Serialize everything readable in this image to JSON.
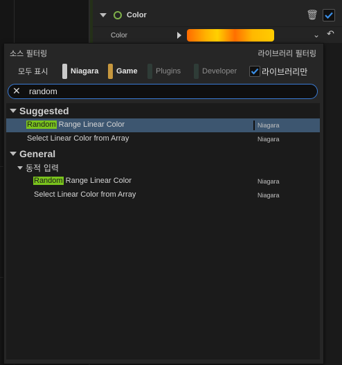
{
  "details": {
    "color_header_label": "Color",
    "color_value_label": "Color"
  },
  "popup": {
    "source_filter_label": "소스 필터링",
    "library_filter_label": "라이브러리 필터링",
    "chips": {
      "show_all": "모두 표시",
      "niagara": "Niagara",
      "game": "Game",
      "plugins": "Plugins",
      "developer": "Developer"
    },
    "library_only_label": "라이브러리만",
    "library_only_checked": true,
    "search": {
      "value": "random"
    },
    "sections": {
      "suggested": "Suggested",
      "general": "General",
      "dynamic_inputs": "동적 입력"
    },
    "results": [
      {
        "match": "Random",
        "rest": " Range Linear Color",
        "source": "Niagara",
        "selected": true
      },
      {
        "match": "",
        "rest": "Select Linear Color from Array",
        "source": "Niagara",
        "selected": false
      },
      {
        "match": "Random",
        "rest": " Range Linear Color",
        "source": "Niagara",
        "selected": false
      },
      {
        "match": "",
        "rest": "Select Linear Color from Array",
        "source": "Niagara",
        "selected": false
      }
    ]
  },
  "colors": {
    "accent_blue": "#3a7bd5",
    "highlight_green": "#7ac31d",
    "niagara_chip": "#c9c9c9",
    "game_chip": "#c6973e",
    "selection": "#3d5670"
  },
  "icons": [
    "chevron-down-icon",
    "ring-icon",
    "trash-icon",
    "checkbox-icon",
    "play-icon",
    "undo-icon",
    "clear-icon"
  ]
}
